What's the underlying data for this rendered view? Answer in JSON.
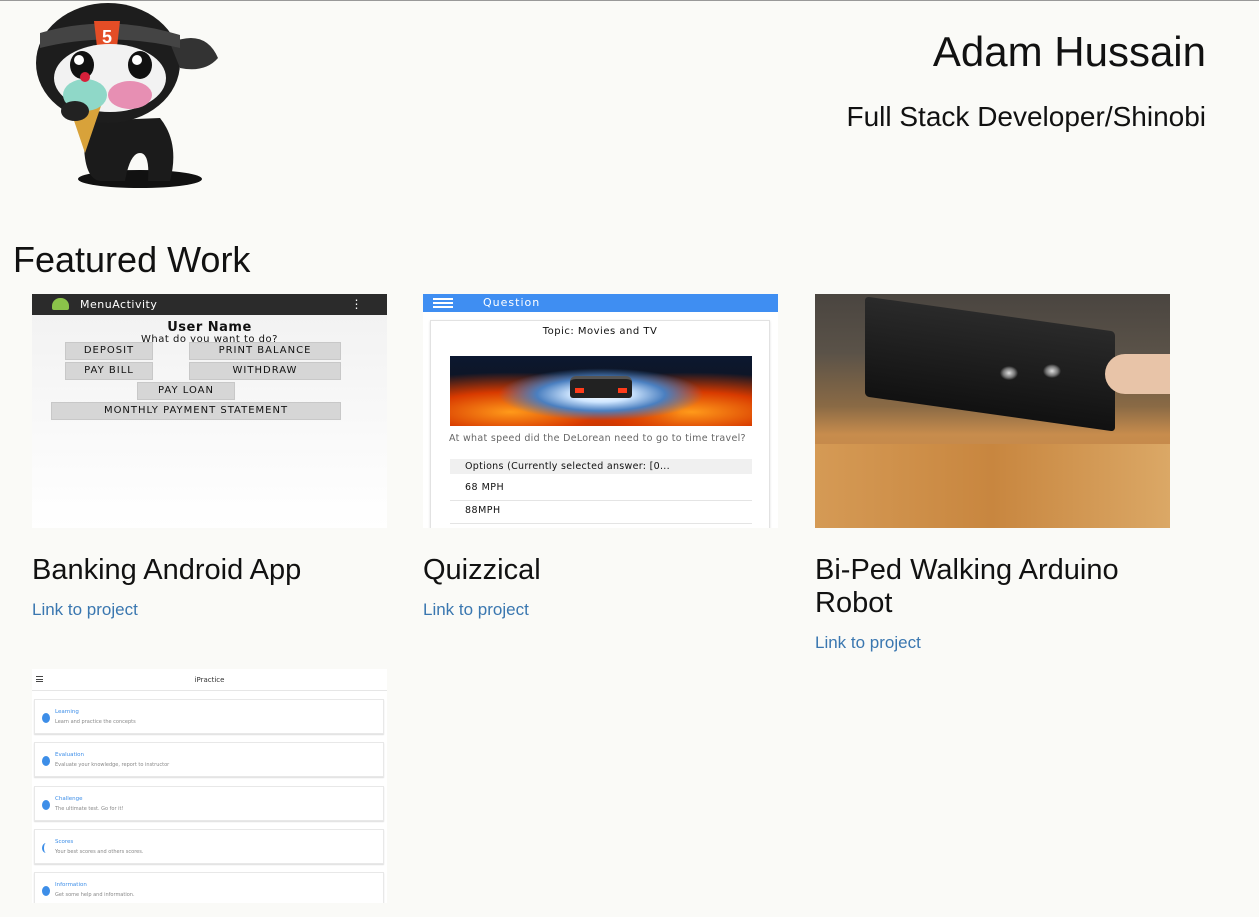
{
  "header": {
    "name": "Adam Hussain",
    "title": "Full Stack Developer/Shinobi",
    "logo_icon": "html5-ninja-mascot-icon",
    "logo_badge": "5"
  },
  "featured": {
    "heading": "Featured Work",
    "projects": [
      {
        "title": "Banking Android App",
        "link": "Link to project",
        "screenshot": {
          "app_bar": "MenuActivity",
          "user_name": "User Name",
          "prompt": "What do you want to do?",
          "buttons": [
            "DEPOSIT",
            "PRINT BALANCE",
            "PAY BILL",
            "WITHDRAW",
            "PAY LOAN",
            "MONTHLY PAYMENT STATEMENT"
          ]
        }
      },
      {
        "title": "Quizzical",
        "link": "Link to project",
        "screenshot": {
          "app_bar": "Question",
          "topic": "Topic: Movies and TV",
          "question": "At what speed did the DeLorean need to go to time travel?",
          "options_header": "Options (Currently selected answer: [0...",
          "options": [
            "68 MPH",
            "88MPH"
          ]
        }
      },
      {
        "title": "Bi-Ped Walking Arduino Robot",
        "link": "Link to project"
      },
      {
        "title": "",
        "link": "",
        "screenshot": {
          "app_bar": "iPractice",
          "items": [
            {
              "title": "Learning",
              "subtitle": "Learn and practice the concepts"
            },
            {
              "title": "Evaluation",
              "subtitle": "Evaluate your knowledge, report to instructor"
            },
            {
              "title": "Challenge",
              "subtitle": "The ultimate test. Go for it!"
            },
            {
              "title": "Scores",
              "subtitle": "Your best scores and others scores."
            },
            {
              "title": "Information",
              "subtitle": "Get some help and information."
            }
          ]
        }
      }
    ]
  },
  "colors": {
    "background": "#fafaf7",
    "link": "#3a77b0",
    "quiz_bar": "#3f8ef2",
    "bank_bar": "#2b2b2b"
  }
}
